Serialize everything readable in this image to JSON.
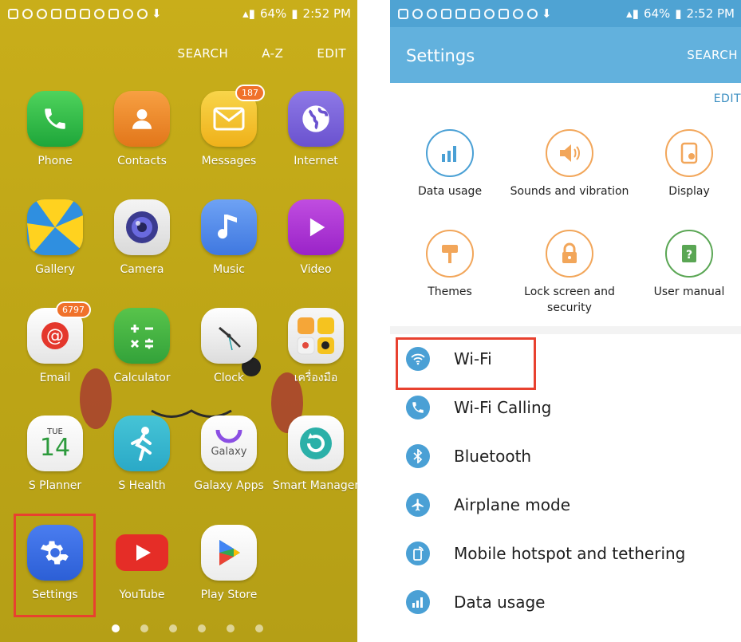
{
  "left": {
    "status": {
      "battery": "64%",
      "time": "2:52 PM"
    },
    "topbar": {
      "search": "SEARCH",
      "az": "A-Z",
      "edit": "EDIT"
    },
    "apps": [
      {
        "label": "Phone"
      },
      {
        "label": "Contacts"
      },
      {
        "label": "Messages",
        "badge": "187"
      },
      {
        "label": "Internet"
      },
      {
        "label": "Gallery"
      },
      {
        "label": "Camera"
      },
      {
        "label": "Music"
      },
      {
        "label": "Video"
      },
      {
        "label": "Email",
        "badge": "6797"
      },
      {
        "label": "Calculator"
      },
      {
        "label": "Clock"
      },
      {
        "label": "เครื่องมือ"
      },
      {
        "label": "S Planner",
        "day": "TUE",
        "date": "14"
      },
      {
        "label": "S Health"
      },
      {
        "label": "Galaxy Apps",
        "inner": "Galaxy"
      },
      {
        "label": "Smart Manager"
      },
      {
        "label": "Settings"
      },
      {
        "label": "YouTube"
      },
      {
        "label": "Play Store"
      }
    ]
  },
  "right": {
    "status": {
      "battery": "64%",
      "time": "2:52 PM"
    },
    "title": "Settings",
    "search": "SEARCH",
    "edit": "EDIT",
    "quick": [
      {
        "label": "Data usage",
        "icon": "bar-chart-icon"
      },
      {
        "label": "Sounds and vibration",
        "icon": "speaker-icon"
      },
      {
        "label": "Display",
        "icon": "display-icon"
      },
      {
        "label": "Themes",
        "icon": "paint-roller-icon"
      },
      {
        "label": "Lock screen and security",
        "icon": "lock-icon"
      },
      {
        "label": "User manual",
        "icon": "help-book-icon"
      }
    ],
    "list": [
      {
        "label": "Wi-Fi",
        "icon": "wifi-icon"
      },
      {
        "label": "Wi-Fi Calling",
        "icon": "wifi-calling-icon"
      },
      {
        "label": "Bluetooth",
        "icon": "bluetooth-icon"
      },
      {
        "label": "Airplane mode",
        "icon": "airplane-icon"
      },
      {
        "label": "Mobile hotspot and tethering",
        "icon": "hotspot-icon"
      },
      {
        "label": "Data usage",
        "icon": "data-usage-icon"
      }
    ]
  },
  "colors": {
    "highlight": "#e8412f",
    "header": "#62b1dd",
    "accent": "#4aa0d5",
    "wallpaper": "#c4ab18"
  }
}
